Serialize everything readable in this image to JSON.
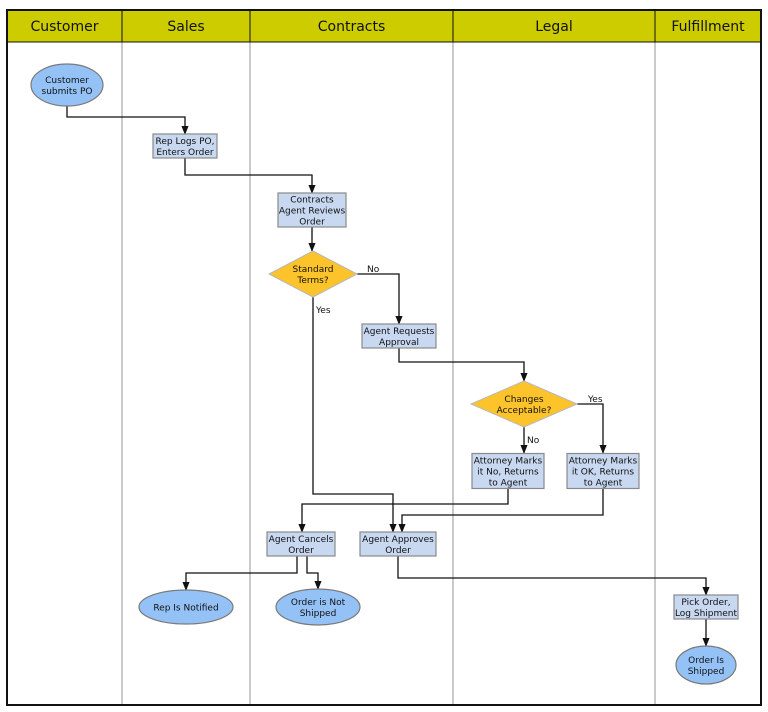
{
  "diagram": {
    "type": "swimlane-flowchart",
    "colors": {
      "header_fill": "#cccc00",
      "border": "#111111",
      "lane_divider": "#b8b8b8",
      "process_fill": "#c7d8f0",
      "process_stroke": "#8a8a8a",
      "terminal_fill": "#94c2f7",
      "terminal_stroke": "#7a7a7a",
      "decision_fill": "#fdc32b",
      "decision_stroke": "#b8b8b8",
      "connector": "#111111"
    },
    "lanes": [
      {
        "id": "customer",
        "title": "Customer"
      },
      {
        "id": "sales",
        "title": "Sales"
      },
      {
        "id": "contracts",
        "title": "Contracts"
      },
      {
        "id": "legal",
        "title": "Legal"
      },
      {
        "id": "fulfillment",
        "title": "Fulfillment"
      }
    ],
    "nodes": [
      {
        "id": "customer-submits-po",
        "shape": "terminal",
        "lane": "customer",
        "lines": [
          "Customer",
          "submits PO"
        ]
      },
      {
        "id": "rep-logs-po",
        "shape": "process",
        "lane": "sales",
        "lines": [
          "Rep Logs PO,",
          "Enters Order"
        ]
      },
      {
        "id": "agent-reviews-order",
        "shape": "process",
        "lane": "contracts",
        "lines": [
          "Contracts",
          "Agent Reviews",
          "Order"
        ]
      },
      {
        "id": "standard-terms",
        "shape": "decision",
        "lane": "contracts",
        "lines": [
          "Standard",
          "Terms?"
        ]
      },
      {
        "id": "agent-requests-approval",
        "shape": "process",
        "lane": "contracts",
        "lines": [
          "Agent Requests",
          "Approval"
        ]
      },
      {
        "id": "changes-acceptable",
        "shape": "decision",
        "lane": "legal",
        "lines": [
          "Changes",
          "Acceptable?"
        ]
      },
      {
        "id": "attorney-marks-no",
        "shape": "process",
        "lane": "legal",
        "lines": [
          "Attorney Marks",
          "it No, Returns",
          "to Agent"
        ]
      },
      {
        "id": "attorney-marks-ok",
        "shape": "process",
        "lane": "legal",
        "lines": [
          "Attorney Marks",
          "it OK, Returns",
          "to Agent"
        ]
      },
      {
        "id": "agent-cancels-order",
        "shape": "process",
        "lane": "contracts",
        "lines": [
          "Agent Cancels",
          "Order"
        ]
      },
      {
        "id": "agent-approves-order",
        "shape": "process",
        "lane": "contracts",
        "lines": [
          "Agent Approves",
          "Order"
        ]
      },
      {
        "id": "rep-is-notified",
        "shape": "terminal",
        "lane": "sales",
        "lines": [
          "Rep Is Notified"
        ]
      },
      {
        "id": "order-not-shipped",
        "shape": "terminal",
        "lane": "contracts",
        "lines": [
          "Order is Not",
          "Shipped"
        ]
      },
      {
        "id": "pick-order",
        "shape": "process",
        "lane": "fulfillment",
        "lines": [
          "Pick Order,",
          "Log Shipment"
        ]
      },
      {
        "id": "order-is-shipped",
        "shape": "terminal",
        "lane": "fulfillment",
        "lines": [
          "Order Is",
          "Shipped"
        ]
      }
    ],
    "edges": [
      {
        "from": "customer-submits-po",
        "to": "rep-logs-po",
        "label": ""
      },
      {
        "from": "rep-logs-po",
        "to": "agent-reviews-order",
        "label": ""
      },
      {
        "from": "agent-reviews-order",
        "to": "standard-terms",
        "label": ""
      },
      {
        "from": "standard-terms",
        "to": "agent-requests-approval",
        "label": "No"
      },
      {
        "from": "standard-terms",
        "to": "agent-approves-order",
        "label": "Yes"
      },
      {
        "from": "agent-requests-approval",
        "to": "changes-acceptable",
        "label": ""
      },
      {
        "from": "changes-acceptable",
        "to": "attorney-marks-no",
        "label": "No"
      },
      {
        "from": "changes-acceptable",
        "to": "attorney-marks-ok",
        "label": "Yes"
      },
      {
        "from": "attorney-marks-no",
        "to": "agent-cancels-order",
        "label": ""
      },
      {
        "from": "attorney-marks-ok",
        "to": "agent-approves-order",
        "label": ""
      },
      {
        "from": "agent-cancels-order",
        "to": "rep-is-notified",
        "label": ""
      },
      {
        "from": "agent-cancels-order",
        "to": "order-not-shipped",
        "label": ""
      },
      {
        "from": "agent-approves-order",
        "to": "pick-order",
        "label": ""
      },
      {
        "from": "pick-order",
        "to": "order-is-shipped",
        "label": ""
      }
    ]
  }
}
